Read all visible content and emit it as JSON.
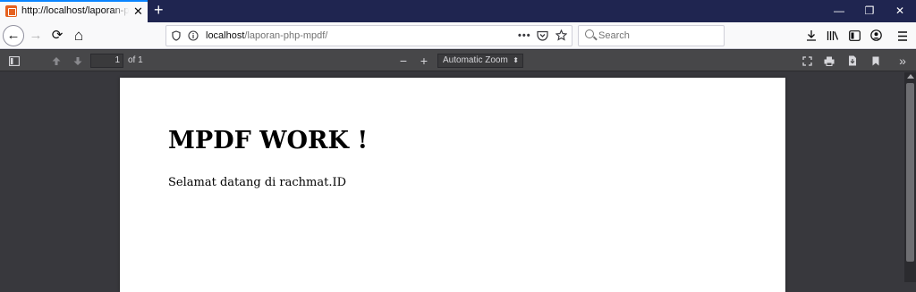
{
  "tab": {
    "title": "http://localhost/laporan-php-mpdf/",
    "close": "✕"
  },
  "new_tab": "+",
  "window_controls": {
    "minimize": "—",
    "restore": "❐",
    "close": "✕"
  },
  "nav": {
    "back": "←",
    "forward": "→",
    "reload": "⟳",
    "home": "⌂",
    "url_host": "localhost",
    "url_path": "/laporan-php-mpdf/",
    "page_actions": "•••",
    "search_placeholder": "Search"
  },
  "icons": {
    "shield": "shield-icon",
    "info": "info-icon",
    "pocket": "pocket-icon",
    "bookmark_star": "star-icon",
    "download": "download-icon",
    "library": "library-icon",
    "sidebar": "sidebar-icon",
    "account": "account-icon",
    "menu": "menu-icon"
  },
  "pdf_toolbar": {
    "page_number": "1",
    "page_count": "of 1",
    "zoom_out": "−",
    "zoom_in": "+",
    "zoom_value": "Automatic Zoom",
    "more": "»"
  },
  "pdf_page": {
    "title": "MPDF WORK !",
    "body": "Selamat datang di rachmat.ID"
  },
  "colors": {
    "tabbar": "#1f2550",
    "accent": "#0a84ff",
    "favicon": "#e5611f",
    "viewer_bg": "#38383d",
    "pdf_toolbar": "#474749"
  }
}
